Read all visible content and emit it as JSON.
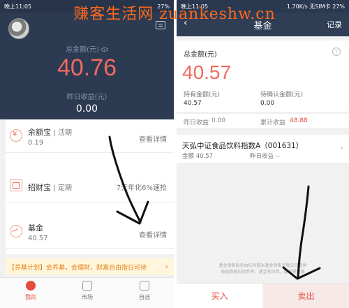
{
  "watermark": "赚客生活网 zuankeshw.cn",
  "left": {
    "status": {
      "time": "晚上11:05",
      "right": "27%"
    },
    "total_label": "总金额(元)",
    "total_value": "40.76",
    "yesterday_label": "昨日收益(元)",
    "yesterday_value": "0.00",
    "items": [
      {
        "name": "余额宝",
        "tag": "| 活期",
        "sub": "0.19",
        "action": "查看详情",
        "icon": "coin-icon"
      },
      {
        "name": "招财宝",
        "tag": "| 定期",
        "sub": "",
        "action": "7天年化6%速抢",
        "icon": "bank-icon"
      },
      {
        "name": "基金",
        "tag": "",
        "sub": "40.57",
        "action": "查看详情",
        "icon": "chart-icon"
      }
    ],
    "banner": "【养基计划】会养基，会理财，财富自由指日可待",
    "tabs": [
      {
        "label": "我的",
        "icon": "user-icon"
      },
      {
        "label": "市场",
        "icon": "market-icon"
      },
      {
        "label": "自选",
        "icon": "star-icon"
      }
    ]
  },
  "right": {
    "status": {
      "time": "晚上11:05",
      "right": "1.70K/s 无SIM卡 27%"
    },
    "title": "基金",
    "records": "记录",
    "total_label": "总金额(元)",
    "total_value": "40.57",
    "hold_label": "持有金额(元)",
    "hold_value": "40.57",
    "pending_label": "待确认金额(元)",
    "pending_value": "0.00",
    "yesterday_label": "昨日收益",
    "yesterday_value": "0.00",
    "cumulative_label": "累计收益",
    "cumulative_value": "48.88",
    "fund_name": "天弘中证食品饮料指数A（001631）",
    "fund_amount": "金额 40.57",
    "fund_yesterday": "昨日收益 --",
    "disclaimer_1": "基金销售服务由杭州数米基金销售有限公司提供",
    "disclaimer_2": "收益数据仅供参考，基金有风险，投资需谨慎",
    "buy_label": "买入",
    "sell_label": "卖出"
  },
  "colors": {
    "accent": "#e34b3c",
    "header": "#2c3a52",
    "watermark": "#ff6a1a"
  }
}
